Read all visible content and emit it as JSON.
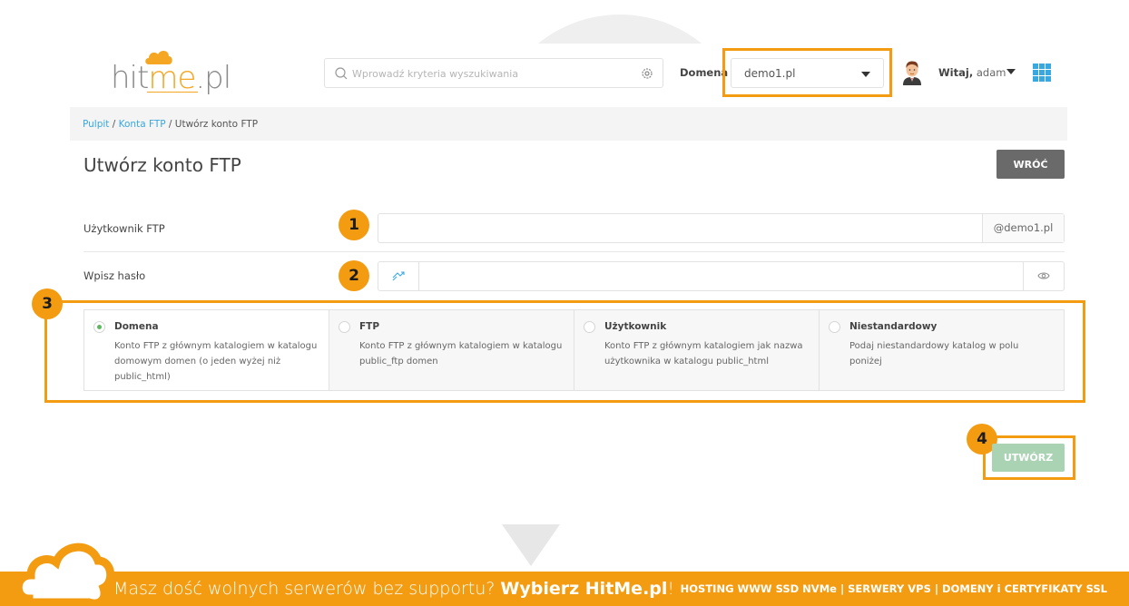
{
  "header": {
    "logo": {
      "prefix": "hit",
      "accent": "me",
      "suffix": ".pl"
    },
    "search": {
      "placeholder": "Wprowadź kryteria wyszukiwania"
    },
    "domain_label": "Domena",
    "domain_value": "demo1.pl",
    "greeting_bold": "Witaj,",
    "user_name": "adam"
  },
  "breadcrumb": {
    "items": [
      "Pulpit",
      "Konta FTP"
    ],
    "separator": " / ",
    "current": "Utwórz konto FTP"
  },
  "page": {
    "title": "Utwórz konto FTP",
    "back_label": "WRÓĆ"
  },
  "form": {
    "user_label": "Użytkownik FTP",
    "user_value": "",
    "user_suffix": "@demo1.pl",
    "password_label": "Wpisz hasło",
    "password_value": "",
    "options": [
      {
        "title": "Domena",
        "desc": "Konto FTP z głównym katalogiem w katalogu domowym domen (o jeden wyżej niż public_html)",
        "checked": true
      },
      {
        "title": "FTP",
        "desc": "Konto FTP z głównym katalogiem w katalogu public_ftp domen",
        "checked": false
      },
      {
        "title": "Użytkownik",
        "desc": "Konto FTP z głównym katalogiem jak nazwa użytkownika w katalogu public_html",
        "checked": false
      },
      {
        "title": "Niestandardowy",
        "desc": "Podaj niestandardowy katalog w polu poniżej",
        "checked": false
      }
    ],
    "create_label": "UTWÓRZ"
  },
  "annotations": {
    "badge1": "1",
    "badge2": "2",
    "badge3": "3",
    "badge4": "4"
  },
  "footer": {
    "slogan_text": "Masz dość wolnych serwerów bez supportu?",
    "slogan_bold": "Wybierz HitMe.pl",
    "slogan_end": "!",
    "links": "HOSTING WWW SSD NVMe | SERWERY VPS | DOMENY i CERTYFIKATY SSL"
  },
  "colors": {
    "accent": "#f39c12",
    "link": "#39a8e0",
    "create_button": "#a9d3b3",
    "back_button": "#6a6a6a",
    "radio_checked": "#5cb85c"
  }
}
